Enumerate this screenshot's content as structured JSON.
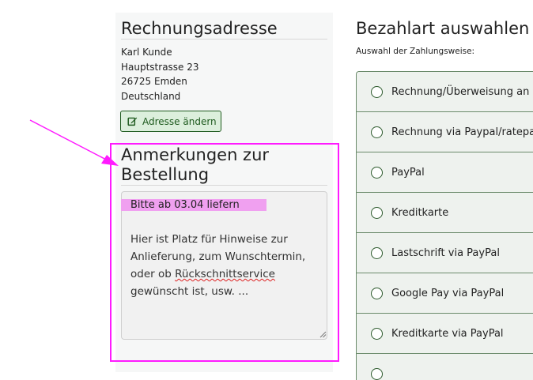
{
  "billing": {
    "title": "Rechnungsadresse",
    "name": "Karl Kunde",
    "street": "Hauptstrasse 23",
    "city": "26725 Emden",
    "country": "Deutschland",
    "edit_label": "Adresse ändern"
  },
  "notes": {
    "title_line1": "Anmerkungen zur",
    "title_line2": "Bestellung",
    "value": "Bitte ab 03.04 liefern",
    "placeholder_line1": "Hier ist Platz für Hinweise zur",
    "placeholder_line2": "Anlieferung, zum Wunschtermin,",
    "placeholder_line3_a": "oder ob ",
    "placeholder_line3_b": "Rückschnittservice",
    "placeholder_line4": "gewünscht ist, usw. ..."
  },
  "payment": {
    "title": "Bezahlart auswahlen",
    "subtitle": "Auswahl der Zahlungsweise:",
    "options": [
      "Rechnung/Überweisung an",
      "Rechnung via Paypal/ratepa",
      "PayPal",
      "Kreditkarte",
      "Lastschrift via PayPal",
      "Google Pay via PayPal",
      "Kreditkarte via PayPal"
    ]
  },
  "colors": {
    "annotation": "#ff1aff",
    "highlight": "#f0a0f0",
    "button_border": "#1e5a1e",
    "button_bg": "#dcefdc",
    "list_border": "#6a8a6a"
  }
}
